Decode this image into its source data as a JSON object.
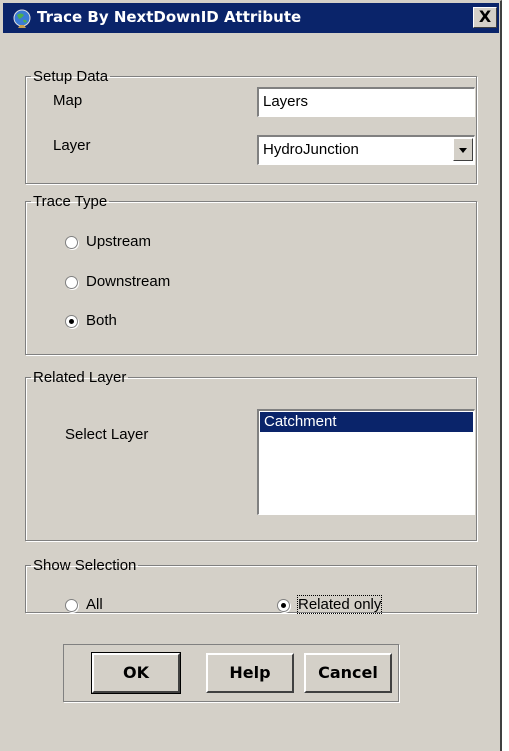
{
  "window": {
    "title": "Trace By NextDownID Attribute",
    "close_label": "X"
  },
  "setup": {
    "title": "Setup Data",
    "map_label": "Map",
    "map_value": "Layers",
    "layer_label": "Layer",
    "layer_value": "HydroJunction"
  },
  "trace": {
    "title": "Trace Type",
    "options": [
      {
        "label": "Upstream",
        "checked": false
      },
      {
        "label": "Downstream",
        "checked": false
      },
      {
        "label": "Both",
        "checked": true
      }
    ]
  },
  "related": {
    "title": "Related Layer",
    "select_label": "Select Layer",
    "items": [
      "Catchment"
    ]
  },
  "show": {
    "title": "Show Selection",
    "options": [
      {
        "label": "All",
        "checked": false
      },
      {
        "label": "Related only",
        "checked": true
      }
    ]
  },
  "buttons": {
    "ok": "OK",
    "help": "Help",
    "cancel": "Cancel"
  },
  "colors": {
    "titlebar": "#0a246a",
    "face": "#d4d0c8",
    "selection": "#0a246a"
  },
  "icons": {
    "app": "globe-icon",
    "close": "close-icon"
  }
}
